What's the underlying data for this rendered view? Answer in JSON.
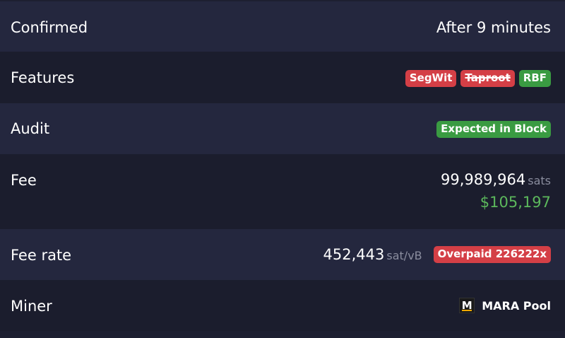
{
  "rows": {
    "confirmed": {
      "label": "Confirmed",
      "value": "After 9 minutes"
    },
    "features": {
      "label": "Features",
      "badges": [
        "SegWit",
        "Taproot",
        "RBF"
      ]
    },
    "audit": {
      "label": "Audit",
      "badge": "Expected in Block"
    },
    "fee": {
      "label": "Fee",
      "amount": "99,989,964",
      "unit": "sats",
      "fiat": "$105,197"
    },
    "fee_rate": {
      "label": "Fee rate",
      "amount": "452,443",
      "unit": "sat/vB",
      "badge": "Overpaid 226222x"
    },
    "miner": {
      "label": "Miner",
      "icon_letter": "M",
      "name": "MARA Pool"
    }
  },
  "colors": {
    "badge_red": "#d43f46",
    "badge_green": "#3a9b42",
    "fiat_green": "#5cb85c",
    "unit_gray": "#8a8d9e"
  }
}
